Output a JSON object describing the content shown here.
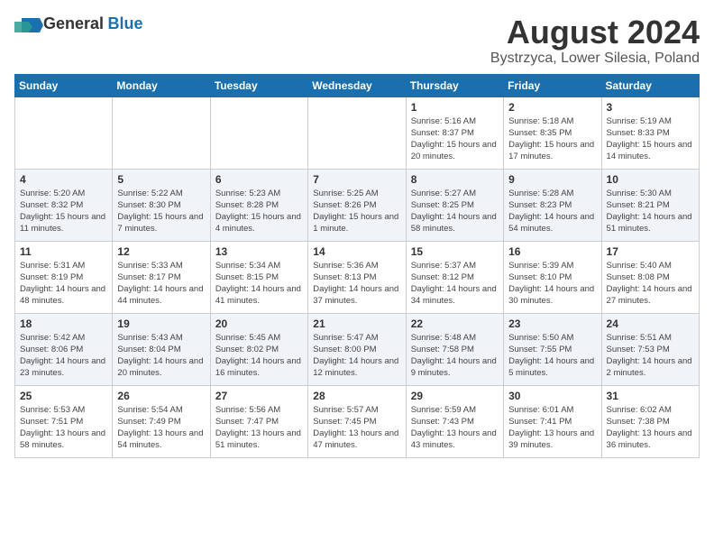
{
  "header": {
    "logo_general": "General",
    "logo_blue": "Blue",
    "title": "August 2024",
    "subtitle": "Bystrzyca, Lower Silesia, Poland"
  },
  "weekdays": [
    "Sunday",
    "Monday",
    "Tuesday",
    "Wednesday",
    "Thursday",
    "Friday",
    "Saturday"
  ],
  "weeks": [
    [
      {
        "day": "",
        "content": ""
      },
      {
        "day": "",
        "content": ""
      },
      {
        "day": "",
        "content": ""
      },
      {
        "day": "",
        "content": ""
      },
      {
        "day": "1",
        "content": "Sunrise: 5:16 AM\nSunset: 8:37 PM\nDaylight: 15 hours\nand 20 minutes."
      },
      {
        "day": "2",
        "content": "Sunrise: 5:18 AM\nSunset: 8:35 PM\nDaylight: 15 hours\nand 17 minutes."
      },
      {
        "day": "3",
        "content": "Sunrise: 5:19 AM\nSunset: 8:33 PM\nDaylight: 15 hours\nand 14 minutes."
      }
    ],
    [
      {
        "day": "4",
        "content": "Sunrise: 5:20 AM\nSunset: 8:32 PM\nDaylight: 15 hours\nand 11 minutes."
      },
      {
        "day": "5",
        "content": "Sunrise: 5:22 AM\nSunset: 8:30 PM\nDaylight: 15 hours\nand 7 minutes."
      },
      {
        "day": "6",
        "content": "Sunrise: 5:23 AM\nSunset: 8:28 PM\nDaylight: 15 hours\nand 4 minutes."
      },
      {
        "day": "7",
        "content": "Sunrise: 5:25 AM\nSunset: 8:26 PM\nDaylight: 15 hours\nand 1 minute."
      },
      {
        "day": "8",
        "content": "Sunrise: 5:27 AM\nSunset: 8:25 PM\nDaylight: 14 hours\nand 58 minutes."
      },
      {
        "day": "9",
        "content": "Sunrise: 5:28 AM\nSunset: 8:23 PM\nDaylight: 14 hours\nand 54 minutes."
      },
      {
        "day": "10",
        "content": "Sunrise: 5:30 AM\nSunset: 8:21 PM\nDaylight: 14 hours\nand 51 minutes."
      }
    ],
    [
      {
        "day": "11",
        "content": "Sunrise: 5:31 AM\nSunset: 8:19 PM\nDaylight: 14 hours\nand 48 minutes."
      },
      {
        "day": "12",
        "content": "Sunrise: 5:33 AM\nSunset: 8:17 PM\nDaylight: 14 hours\nand 44 minutes."
      },
      {
        "day": "13",
        "content": "Sunrise: 5:34 AM\nSunset: 8:15 PM\nDaylight: 14 hours\nand 41 minutes."
      },
      {
        "day": "14",
        "content": "Sunrise: 5:36 AM\nSunset: 8:13 PM\nDaylight: 14 hours\nand 37 minutes."
      },
      {
        "day": "15",
        "content": "Sunrise: 5:37 AM\nSunset: 8:12 PM\nDaylight: 14 hours\nand 34 minutes."
      },
      {
        "day": "16",
        "content": "Sunrise: 5:39 AM\nSunset: 8:10 PM\nDaylight: 14 hours\nand 30 minutes."
      },
      {
        "day": "17",
        "content": "Sunrise: 5:40 AM\nSunset: 8:08 PM\nDaylight: 14 hours\nand 27 minutes."
      }
    ],
    [
      {
        "day": "18",
        "content": "Sunrise: 5:42 AM\nSunset: 8:06 PM\nDaylight: 14 hours\nand 23 minutes."
      },
      {
        "day": "19",
        "content": "Sunrise: 5:43 AM\nSunset: 8:04 PM\nDaylight: 14 hours\nand 20 minutes."
      },
      {
        "day": "20",
        "content": "Sunrise: 5:45 AM\nSunset: 8:02 PM\nDaylight: 14 hours\nand 16 minutes."
      },
      {
        "day": "21",
        "content": "Sunrise: 5:47 AM\nSunset: 8:00 PM\nDaylight: 14 hours\nand 12 minutes."
      },
      {
        "day": "22",
        "content": "Sunrise: 5:48 AM\nSunset: 7:58 PM\nDaylight: 14 hours\nand 9 minutes."
      },
      {
        "day": "23",
        "content": "Sunrise: 5:50 AM\nSunset: 7:55 PM\nDaylight: 14 hours\nand 5 minutes."
      },
      {
        "day": "24",
        "content": "Sunrise: 5:51 AM\nSunset: 7:53 PM\nDaylight: 14 hours\nand 2 minutes."
      }
    ],
    [
      {
        "day": "25",
        "content": "Sunrise: 5:53 AM\nSunset: 7:51 PM\nDaylight: 13 hours\nand 58 minutes."
      },
      {
        "day": "26",
        "content": "Sunrise: 5:54 AM\nSunset: 7:49 PM\nDaylight: 13 hours\nand 54 minutes."
      },
      {
        "day": "27",
        "content": "Sunrise: 5:56 AM\nSunset: 7:47 PM\nDaylight: 13 hours\nand 51 minutes."
      },
      {
        "day": "28",
        "content": "Sunrise: 5:57 AM\nSunset: 7:45 PM\nDaylight: 13 hours\nand 47 minutes."
      },
      {
        "day": "29",
        "content": "Sunrise: 5:59 AM\nSunset: 7:43 PM\nDaylight: 13 hours\nand 43 minutes."
      },
      {
        "day": "30",
        "content": "Sunrise: 6:01 AM\nSunset: 7:41 PM\nDaylight: 13 hours\nand 39 minutes."
      },
      {
        "day": "31",
        "content": "Sunrise: 6:02 AM\nSunset: 7:38 PM\nDaylight: 13 hours\nand 36 minutes."
      }
    ]
  ]
}
